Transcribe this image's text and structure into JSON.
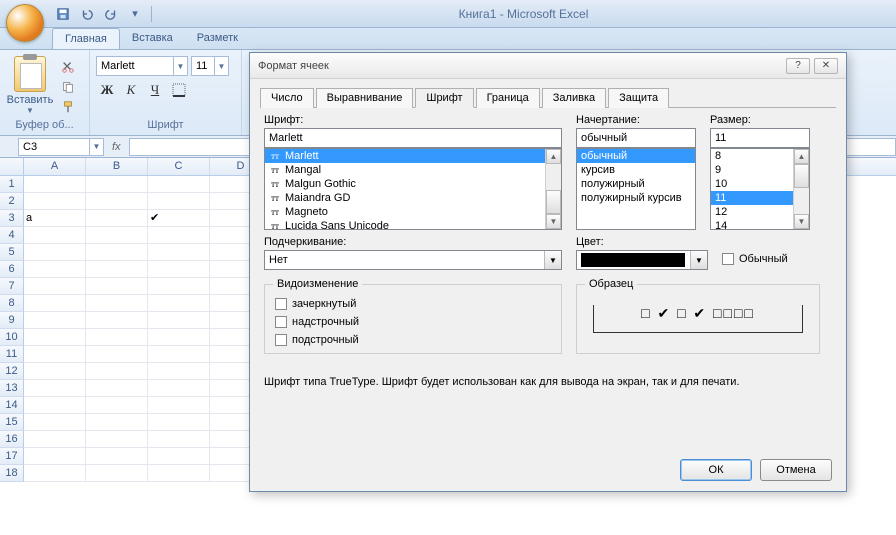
{
  "app": {
    "title": "Книга1  -  Microsoft Excel"
  },
  "ribbon": {
    "tabs": [
      "Главная",
      "Вставка",
      "Разметк"
    ],
    "paste_label": "Вставить",
    "clipboard_group": "Буфер об...",
    "font_group": "Шрифт",
    "font_name": "Marlett",
    "font_size": "11",
    "b": "Ж",
    "i": "К",
    "u": "Ч"
  },
  "formula": {
    "namebox": "C3",
    "fx": "fx"
  },
  "grid": {
    "cols": [
      "A",
      "B",
      "C",
      "D"
    ],
    "rows": [
      "1",
      "2",
      "3",
      "4",
      "5",
      "6",
      "7",
      "8",
      "9",
      "10",
      "11",
      "12",
      "13",
      "14",
      "15",
      "16",
      "17",
      "18"
    ],
    "cells": {
      "A3": "a",
      "C3": "✔"
    }
  },
  "dialog": {
    "title": "Формат ячеек",
    "tabs": [
      "Число",
      "Выравнивание",
      "Шрифт",
      "Граница",
      "Заливка",
      "Защита"
    ],
    "active_tab": 2,
    "labels": {
      "font": "Шрифт:",
      "style": "Начертание:",
      "size": "Размер:",
      "underline": "Подчеркивание:",
      "color": "Цвет:",
      "normal": "Обычный",
      "effects": "Видоизменение",
      "strike": "зачеркнутый",
      "super": "надстрочный",
      "sub": "подстрочный",
      "sample": "Образец"
    },
    "font_value": "Marlett",
    "font_list": [
      "Lucida Sans Unicode",
      "Magneto",
      "Maiandra GD",
      "Malgun Gothic",
      "Mangal",
      "Marlett"
    ],
    "font_selected": 5,
    "style_value": "обычный",
    "style_list": [
      "обычный",
      "курсив",
      "полужирный",
      "полужирный курсив"
    ],
    "style_selected": 0,
    "size_value": "11",
    "size_list": [
      "8",
      "9",
      "10",
      "11",
      "12",
      "14"
    ],
    "size_selected": 3,
    "underline_value": "Нет",
    "color_value": "#000000",
    "sample_text": "□ ✔ □ ✔ □□□□",
    "note": "Шрифт типа TrueType. Шрифт будет использован как для вывода на экран, так и для печати.",
    "ok": "ОК",
    "cancel": "Отмена"
  }
}
